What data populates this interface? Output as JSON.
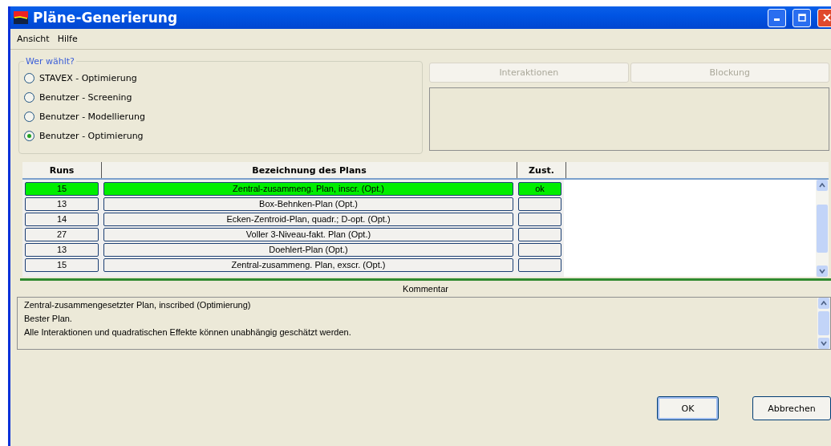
{
  "window": {
    "title": "Pläne-Generierung"
  },
  "menu": [
    {
      "label": "Ansicht"
    },
    {
      "label": "Hilfe"
    }
  ],
  "chooser": {
    "title": "Wer wählt?",
    "options": [
      {
        "label": "STAVEX - Optimierung",
        "selected": false
      },
      {
        "label": "Benutzer - Screening",
        "selected": false
      },
      {
        "label": "Benutzer - Modellierung",
        "selected": false
      },
      {
        "label": "Benutzer - Optimierung",
        "selected": true
      }
    ]
  },
  "side_buttons": [
    {
      "label": "Interaktionen",
      "disabled": true
    },
    {
      "label": "Blockung",
      "disabled": true
    }
  ],
  "table": {
    "columns": [
      "Runs",
      "Bezeichnung des Plans",
      "Zust."
    ],
    "rows": [
      {
        "runs": "15",
        "name": "Zentral-zusammeng. Plan, inscr. (Opt.)",
        "state": "ok",
        "selected": true
      },
      {
        "runs": "13",
        "name": "Box-Behnken-Plan (Opt.)",
        "state": "",
        "selected": false
      },
      {
        "runs": "14",
        "name": "Ecken-Zentroid-Plan, quadr.; D-opt. (Opt.)",
        "state": "",
        "selected": false
      },
      {
        "runs": "27",
        "name": "Voller 3-Niveau-fakt. Plan (Opt.)",
        "state": "",
        "selected": false
      },
      {
        "runs": "13",
        "name": "Doehlert-Plan (Opt.)",
        "state": "",
        "selected": false
      },
      {
        "runs": "15",
        "name": "Zentral-zusammeng. Plan, exscr. (Opt.)",
        "state": "",
        "selected": false
      }
    ]
  },
  "comment": {
    "title": "Kommentar",
    "lines": [
      "Zentral-zusammengesetzter Plan, inscribed (Optimierung)",
      "Bester Plan.",
      "Alle Interaktionen und quadratischen Effekte können unabhängig geschätzt werden."
    ]
  },
  "buttons": [
    {
      "label": "OK",
      "default": true
    },
    {
      "label": "Abbrechen",
      "default": false
    }
  ]
}
